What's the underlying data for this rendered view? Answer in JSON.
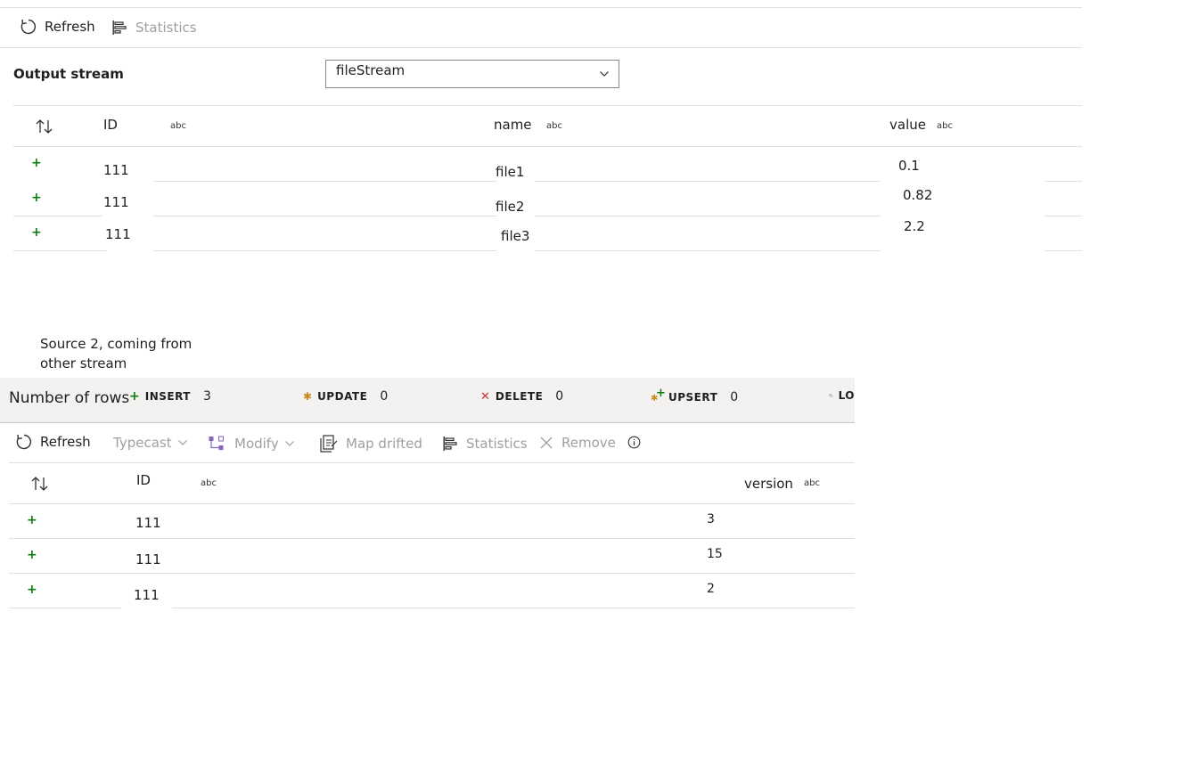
{
  "top_toolbar": {
    "refresh_label": "Refresh",
    "statistics_label": "Statistics"
  },
  "output_stream": {
    "label": "Output stream",
    "selected": "fileStream"
  },
  "output_table": {
    "type_hint": "abc",
    "columns": [
      "ID",
      "name",
      "value"
    ],
    "rows": [
      {
        "id": "111",
        "name": "file1",
        "value": "0.1"
      },
      {
        "id": "111",
        "name": "file2",
        "value": "0.82"
      },
      {
        "id": "111",
        "name": "file3",
        "value": "2.2"
      }
    ]
  },
  "note": {
    "line1": "Source 2, coming from",
    "line2": "other stream"
  },
  "row_summary": {
    "label": "Number of rows",
    "insert": {
      "label": "INSERT",
      "count": "3"
    },
    "update": {
      "label": "UPDATE",
      "count": "0"
    },
    "delete": {
      "label": "DELETE",
      "count": "0"
    },
    "upsert": {
      "label": "UPSERT",
      "count": "0"
    },
    "lookup": {
      "label": "LO"
    }
  },
  "source_toolbar": {
    "refresh_label": "Refresh",
    "typecast_label": "Typecast",
    "modify_label": "Modify",
    "map_drifted_label": "Map drifted",
    "statistics_label": "Statistics",
    "remove_label": "Remove"
  },
  "source_table": {
    "type_hint": "abc",
    "columns": [
      "ID",
      "version"
    ],
    "rows": [
      {
        "id": "111",
        "version": "3"
      },
      {
        "id": "111",
        "version": "15"
      },
      {
        "id": "111",
        "version": "2"
      }
    ]
  },
  "colors": {
    "insert": "#107c10",
    "update": "#ca8a1e",
    "delete": "#d13438",
    "disabled_text": "#a19f9d",
    "divider": "#e1dfdd",
    "summary_bg": "#f3f2f1"
  }
}
